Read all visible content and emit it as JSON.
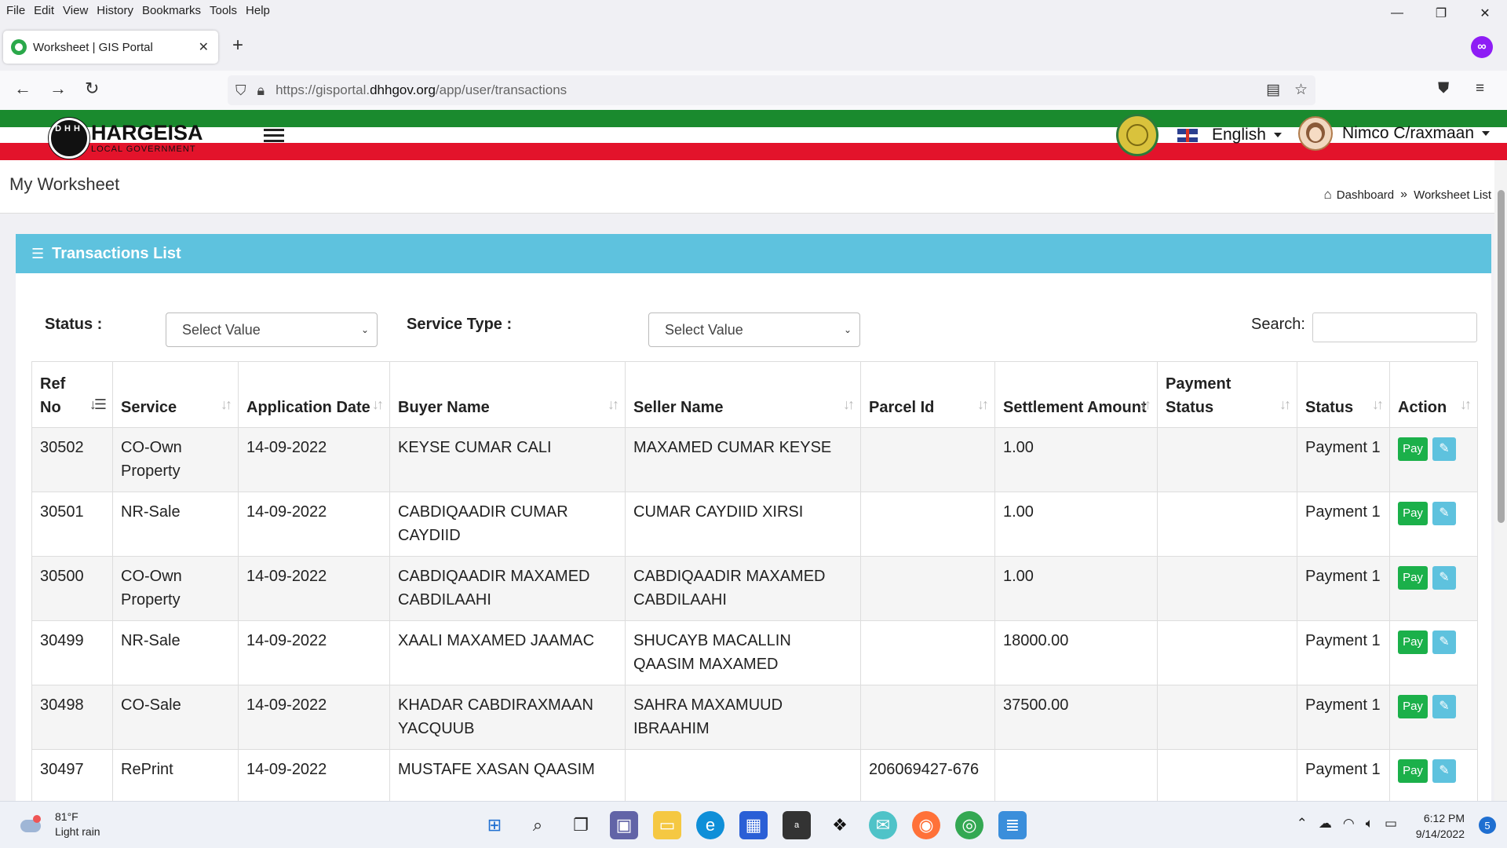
{
  "browser": {
    "menu": [
      "File",
      "Edit",
      "View",
      "History",
      "Bookmarks",
      "Tools",
      "Help"
    ],
    "tab_title": "Worksheet | GIS Portal",
    "url_prefix": "https://gisportal.",
    "url_host": "dhhgov.org",
    "url_path": "/app/user/transactions"
  },
  "site": {
    "logo_title": "HARGEISA",
    "logo_sub": "LOCAL GOVERNMENT",
    "logo_letters": "DHH",
    "language": "English",
    "user_name": "Nimco C/raxmaan"
  },
  "page": {
    "title": "My Worksheet",
    "breadcrumb": [
      "Dashboard",
      "Worksheet List"
    ]
  },
  "panel": {
    "title": "Transactions List",
    "status_label": "Status :",
    "status_value": "Select Value",
    "service_type_label": "Service Type :",
    "service_type_value": "Select Value",
    "search_label": "Search:"
  },
  "table": {
    "headers": [
      "Ref No",
      "Service",
      "Application Date",
      "Buyer Name",
      "Seller Name",
      "Parcel Id",
      "Settlement Amount",
      "Payment Status",
      "Status",
      "Action"
    ],
    "pay_label": "Pay",
    "rows": [
      {
        "ref": "30502",
        "service": "CO-Own Property",
        "date": "14-09-2022",
        "buyer": "KEYSE CUMAR CALI",
        "seller": "MAXAMED CUMAR KEYSE",
        "parcel": "",
        "amount": "1.00",
        "payment_status": "",
        "status": "Payment 1"
      },
      {
        "ref": "30501",
        "service": "NR-Sale",
        "date": "14-09-2022",
        "buyer": "CABDIQAADIR CUMAR CAYDIID",
        "seller": "CUMAR CAYDIID XIRSI",
        "parcel": "",
        "amount": "1.00",
        "payment_status": "",
        "status": "Payment 1"
      },
      {
        "ref": "30500",
        "service": "CO-Own Property",
        "date": "14-09-2022",
        "buyer": "CABDIQAADIR MAXAMED CABDILAAHI",
        "seller": "CABDIQAADIR MAXAMED CABDILAAHI",
        "parcel": "",
        "amount": "1.00",
        "payment_status": "",
        "status": "Payment 1"
      },
      {
        "ref": "30499",
        "service": "NR-Sale",
        "date": "14-09-2022",
        "buyer": "XAALI MAXAMED JAAMAC",
        "seller": "SHUCAYB MACALLIN QAASIM MAXAMED",
        "parcel": "",
        "amount": "18000.00",
        "payment_status": "",
        "status": "Payment 1"
      },
      {
        "ref": "30498",
        "service": "CO-Sale",
        "date": "14-09-2022",
        "buyer": "KHADAR CABDIRAXMAAN YACQUUB",
        "seller": "SAHRA MAXAMUUD IBRAAHIM",
        "parcel": "",
        "amount": "37500.00",
        "payment_status": "",
        "status": "Payment 1"
      },
      {
        "ref": "30497",
        "service": "RePrint",
        "date": "14-09-2022",
        "buyer": "MUSTAFE XASAN QAASIM",
        "seller": "",
        "parcel": "206069427-676",
        "amount": "",
        "payment_status": "",
        "status": "Payment 1"
      }
    ]
  },
  "taskbar": {
    "temperature": "81°F",
    "weather": "Light rain",
    "time": "6:12 PM",
    "date": "9/14/2022",
    "notifications": "5"
  },
  "icons": {
    "accent_header": "#5ec2de",
    "pay_green": "#1bb04a",
    "flag_green": "#1a8a2e",
    "flag_red": "#e3132b"
  }
}
